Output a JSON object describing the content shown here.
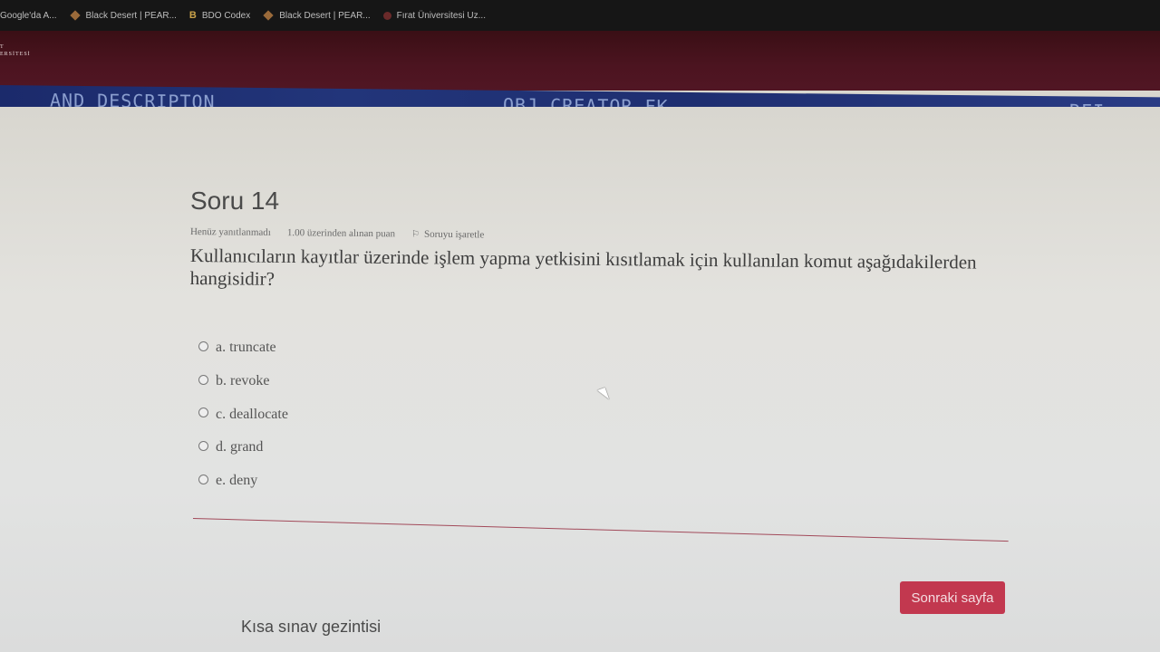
{
  "bookmarks": [
    {
      "label": "Google'da A...",
      "icon": "google-icon"
    },
    {
      "label": "Black Desert | PEAR...",
      "icon": "black-desert-icon"
    },
    {
      "label": "BDO Codex",
      "icon": "bdo-codex-icon"
    },
    {
      "label": "Black Desert | PEAR...",
      "icon": "black-desert-icon"
    },
    {
      "label": "Fırat Üniversitesi Uz...",
      "icon": "firat-icon"
    }
  ],
  "header": {
    "logo_line1": "T",
    "logo_line2": "ERSİTESİ"
  },
  "banner": {
    "text1": "AND DESCRIPTON",
    "text2": "OBJ CREATOR FK",
    "text3": "RFI"
  },
  "question": {
    "title": "Soru 14",
    "status": "Henüz yanıtlanmadı",
    "points": "1.00 üzerinden alınan puan",
    "flag_label": "Soruyu işaretle",
    "text": "Kullanıcıların kayıtlar üzerinde işlem yapma yetkisini kısıtlamak için kullanılan komut aşağıdakilerden hangisidir?",
    "options": [
      "a. truncate",
      "b. revoke",
      "c. deallocate",
      "d. grand",
      "e. deny"
    ]
  },
  "navigation": {
    "next_label": "Sonraki sayfa",
    "quiz_nav_title": "Kısa sınav gezintisi"
  },
  "colors": {
    "header": "#4c1420",
    "accent_button": "#c2384f",
    "divider": "#a24a5a"
  }
}
